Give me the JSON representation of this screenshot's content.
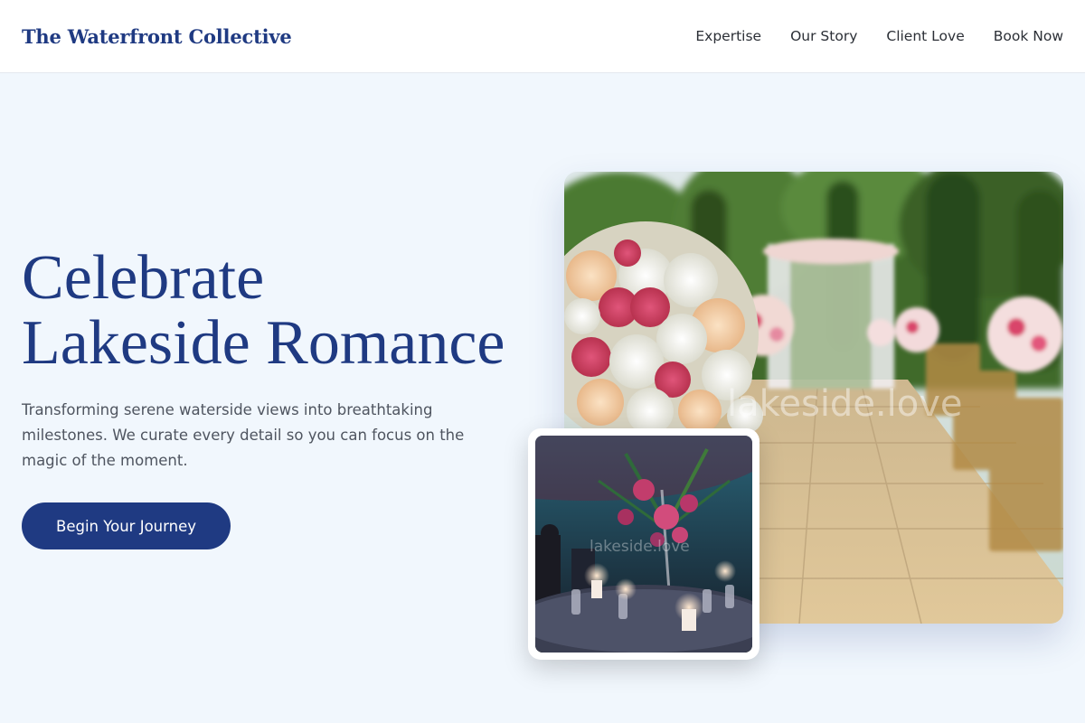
{
  "header": {
    "brand": "The Waterfront Collective",
    "nav": [
      "Expertise",
      "Our Story",
      "Client Love",
      "Book Now"
    ]
  },
  "hero": {
    "title_line1": "Celebrate",
    "title_line2": "Lakeside Romance",
    "description": "Transforming serene waterside views into breathtaking milestones. We curate every detail so you can focus on the magic of the moment.",
    "cta_label": "Begin Your Journey"
  },
  "images": {
    "main_watermark": "lakeside.love",
    "inset_watermark": "lakeside.love"
  },
  "colors": {
    "brand": "#1f3a82",
    "page_background": "#f1f7fd",
    "body_text": "#4f5560"
  }
}
